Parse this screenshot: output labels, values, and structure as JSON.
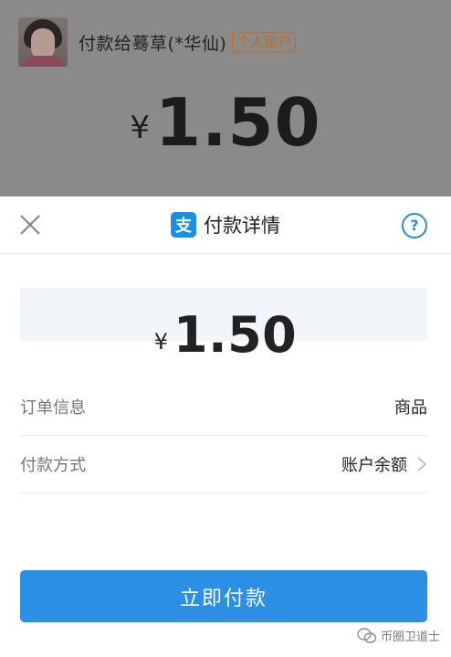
{
  "background": {
    "payee": "付款给蓦草(*华仙)",
    "badge": "个人账户",
    "currency": "¥",
    "amount": "1.50"
  },
  "sheet": {
    "title": "付款详情",
    "logo_glyph": "支",
    "help_glyph": "?",
    "currency": "¥",
    "amount": "1.50",
    "rows": [
      {
        "label": "订单信息",
        "value": "商品"
      },
      {
        "label": "付款方式",
        "value": "账户余额"
      }
    ],
    "pay_button": "立即付款"
  },
  "watermark": "币圈卫道士",
  "colors": {
    "accent": "#2a8fe5",
    "badge": "#c96a1c",
    "help": "#2b8fd6"
  }
}
